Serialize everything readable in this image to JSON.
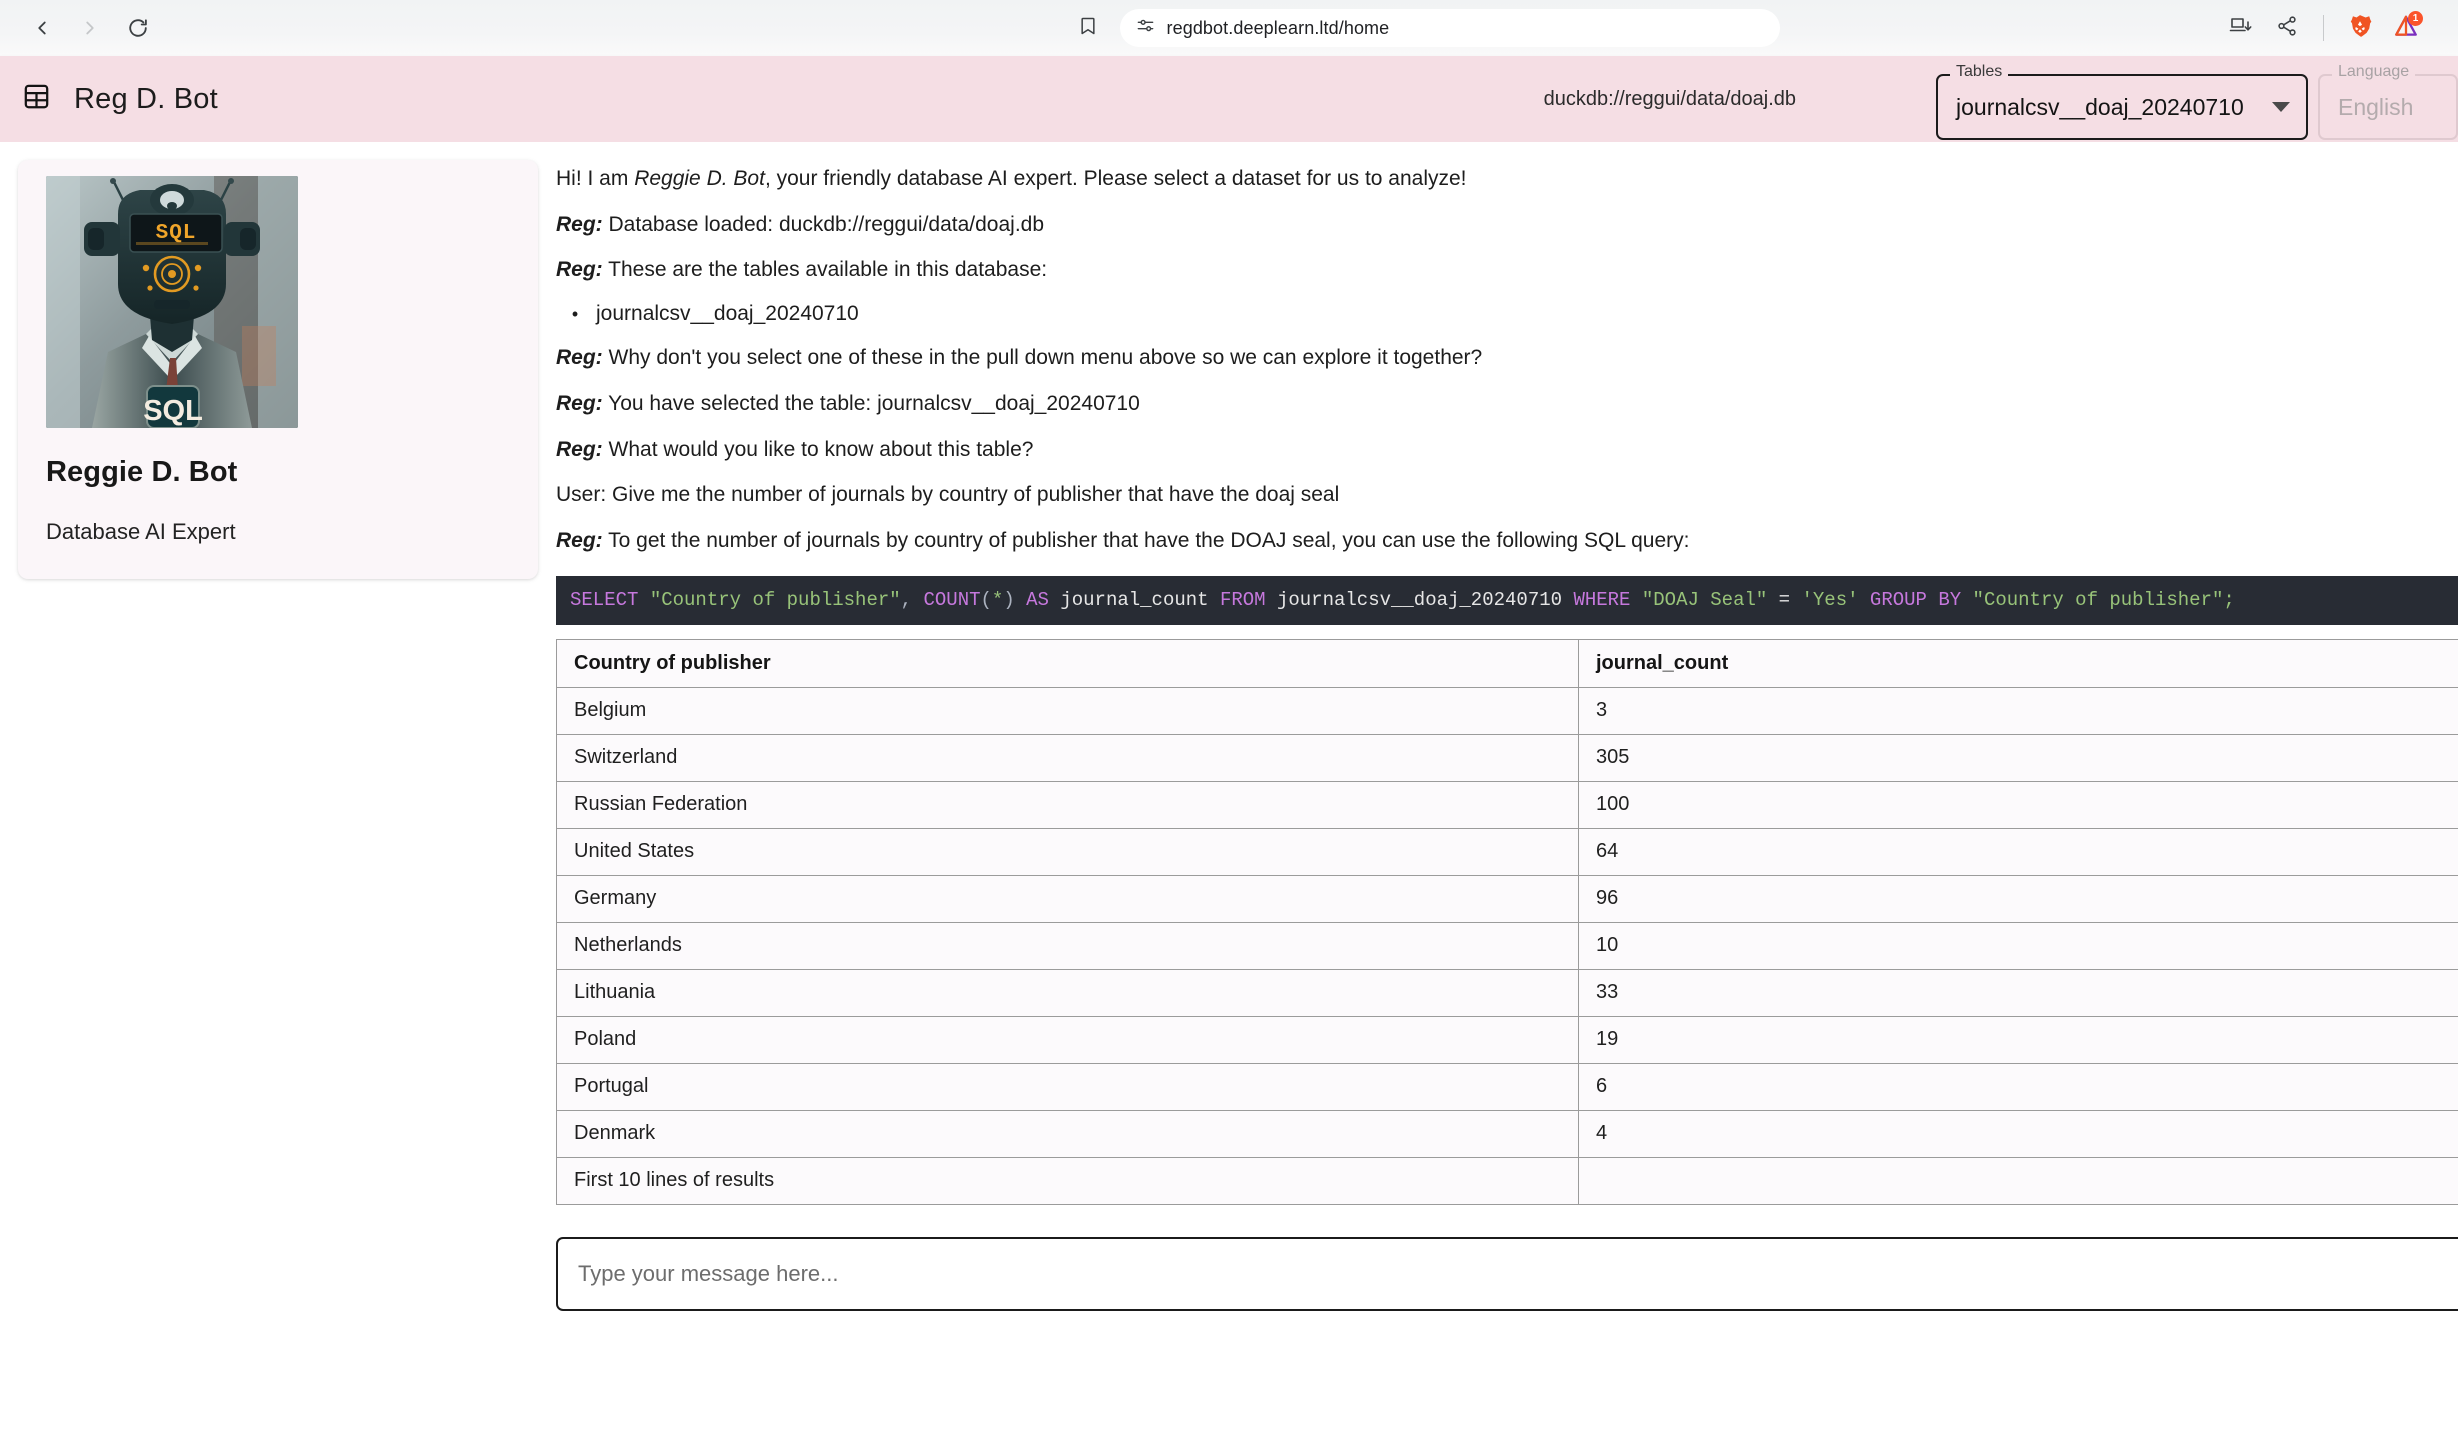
{
  "browser": {
    "url": "regdbot.deeplearn.ltd/home",
    "back_label": "Back",
    "forward_label": "Forward",
    "reload_label": "Reload",
    "bookmark_label": "Bookmark this tab",
    "icons": {
      "back": "back-arrow-icon",
      "forward": "forward-arrow-icon",
      "reload": "reload-icon",
      "bookmark": "bookmark-icon",
      "site_settings": "tune-icon",
      "cast": "cast-download-icon",
      "share": "share-icon",
      "brave": "brave-lion-icon",
      "rewards": "brave-rewards-triangle-icon"
    },
    "rewards_badge": "1"
  },
  "header": {
    "menu_icon": "grid-table-icon",
    "title": "Reg D. Bot",
    "db_uri": "duckdb://reggui/data/doaj.db",
    "tables_field": {
      "label": "Tables",
      "value": "journalcsv__doaj_20240710"
    },
    "language_field": {
      "label": "Language",
      "value": "English"
    },
    "bg_color": "#f5dee4"
  },
  "profile": {
    "avatar_alt": "robot-in-suit-with-sql-display",
    "name": "Reggie D. Bot",
    "role": "Database AI Expert"
  },
  "chat": {
    "messages": [
      {
        "who": "",
        "pre": "Hi! I am ",
        "em": "Reggie D. Bot",
        "post": ", your friendly database AI expert. Please select a dataset for us to analyze!"
      },
      {
        "who": "Reg:",
        "text": "Database loaded: duckdb://reggui/data/doaj.db"
      },
      {
        "who": "Reg:",
        "text": "These are the tables available in this database:"
      },
      {
        "bullet": "journalcsv__doaj_20240710"
      },
      {
        "who": "Reg:",
        "text": "Why don't you select one of these in the pull down menu above so we can explore it together?"
      },
      {
        "who": "Reg:",
        "text": "You have selected the table: journalcsv__doaj_20240710"
      },
      {
        "who": "Reg:",
        "text": "What would you like to know about this table?"
      },
      {
        "who": "User:",
        "text": "Give me the number of journals by country of publisher that have the doaj seal",
        "plain": true
      },
      {
        "who": "Reg:",
        "text": "To get the number of journals by country of publisher that have the DOAJ seal, you can use the following SQL query:"
      }
    ]
  },
  "sql": {
    "tokens": [
      {
        "t": "SELECT",
        "c": "kw"
      },
      {
        "t": " ",
        "c": "pun"
      },
      {
        "t": "\"Country of publisher\"",
        "c": "str"
      },
      {
        "t": ", ",
        "c": "pun"
      },
      {
        "t": "COUNT",
        "c": "kw"
      },
      {
        "t": "(",
        "c": "pun"
      },
      {
        "t": "*",
        "c": "str"
      },
      {
        "t": ") ",
        "c": "pun"
      },
      {
        "t": "AS",
        "c": "kw"
      },
      {
        "t": " journal_count ",
        "c": "idn"
      },
      {
        "t": "FROM",
        "c": "kw"
      },
      {
        "t": " journalcsv__doaj_20240710 ",
        "c": "idn"
      },
      {
        "t": "WHERE",
        "c": "kw"
      },
      {
        "t": " ",
        "c": "pun"
      },
      {
        "t": "\"DOAJ Seal\"",
        "c": "str"
      },
      {
        "t": " = ",
        "c": "idn"
      },
      {
        "t": "'Yes'",
        "c": "str"
      },
      {
        "t": " ",
        "c": "pun"
      },
      {
        "t": "GROUP BY",
        "c": "kw"
      },
      {
        "t": " ",
        "c": "pun"
      },
      {
        "t": "\"Country of publisher\"",
        "c": "str"
      },
      {
        "t": ";",
        "c": "str"
      }
    ],
    "plain": "SELECT \"Country of publisher\", COUNT(*) AS journal_count FROM journalcsv__doaj_20240710 WHERE \"DOAJ Seal\" = 'Yes' GROUP BY \"Country of publisher\";"
  },
  "results": {
    "columns": [
      "Country of publisher",
      "journal_count"
    ],
    "rows": [
      [
        "Belgium",
        "3"
      ],
      [
        "Switzerland",
        "305"
      ],
      [
        "Russian Federation",
        "100"
      ],
      [
        "United States",
        "64"
      ],
      [
        "Germany",
        "96"
      ],
      [
        "Netherlands",
        "10"
      ],
      [
        "Lithuania",
        "33"
      ],
      [
        "Poland",
        "19"
      ],
      [
        "Portugal",
        "6"
      ],
      [
        "Denmark",
        "4"
      ]
    ],
    "footer": "First 10 lines of results"
  },
  "composer": {
    "placeholder": "Type your message here...",
    "value": ""
  }
}
